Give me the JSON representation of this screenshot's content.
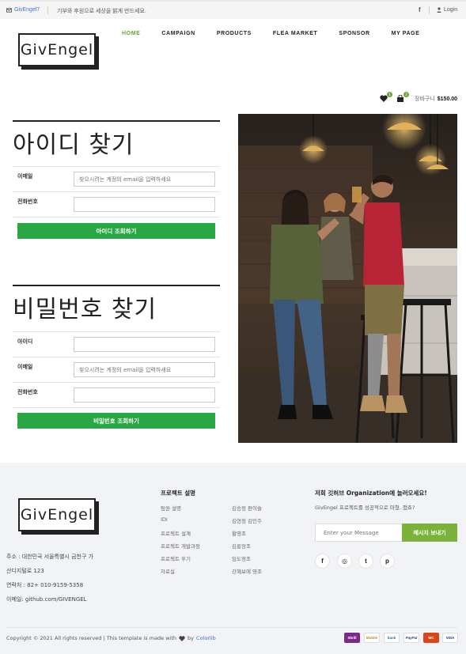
{
  "topbar": {
    "email": "GivEngel7",
    "slogan": "기부와 후원으로 세상을 밝게 만드세요.",
    "facebook": "f",
    "login": "Login"
  },
  "brand": {
    "logo_text": "GivEngel"
  },
  "nav": [
    {
      "label": "HOME",
      "active": true
    },
    {
      "label": "CAMPAIGN",
      "active": false
    },
    {
      "label": "PRODUCTS",
      "active": false
    },
    {
      "label": "FLEA MARKET",
      "active": false
    },
    {
      "label": "SPONSOR",
      "active": false
    },
    {
      "label": "MY PAGE",
      "active": false
    }
  ],
  "cart": {
    "wish_count": "1",
    "cart_count": "2",
    "label": "장바구니",
    "total": "$150.00"
  },
  "find_id": {
    "title": "아이디 찾기",
    "email_label": "이메일",
    "email_placeholder": "찾으시려는 계정의 email을 입력하세요",
    "phone_label": "전화번호",
    "phone_placeholder": "",
    "button": "아이디 조회하기"
  },
  "find_pw": {
    "title": "비밀번호 찾기",
    "id_label": "아이디",
    "id_placeholder": "",
    "email_label": "이메일",
    "email_placeholder": "찾으시려는 계정의 email을 입력하세요",
    "phone_label": "전화번호",
    "phone_placeholder": "",
    "button": "비밀번호 조회하기"
  },
  "footer": {
    "address_line1": "주소 : 대한민국 서울특별시 금천구 가",
    "address_line2": "산디지털로 123",
    "contact": "연락처 : 82+ 010-9159-5358",
    "email": "이메일: github.com/GIVENGEL",
    "project_heading": "프로젝트 설명",
    "project_links_left": [
      "팀원 설명",
      "IDI",
      "프로젝트 설계",
      "프로젝트 개발과정",
      "프로젝트 후기",
      "자료실"
    ],
    "project_links_right": [
      "김승정 편이슬",
      "김연정 김민주",
      "황영조",
      "김릉장조",
      "임도영조",
      "강혜보에 영조"
    ],
    "newsletter_heading": "저희 깃허브 Organization에 놀러오세요!",
    "newsletter_desc": "GivEngel 프로젝트를 성공적으로 마쳤..젔죠?",
    "message_placeholder": "Enter your Message",
    "send_button": "메시지 보내기",
    "social": [
      "f",
      "◎",
      "t",
      "p"
    ],
    "copyright": "Copyright © 2021 All rights reserved | This template is made with",
    "by": "by",
    "author": "Colorlib",
    "payments": [
      "Skrill",
      "Mobile",
      "bank",
      "PayPal",
      "MC",
      "VISA"
    ]
  }
}
